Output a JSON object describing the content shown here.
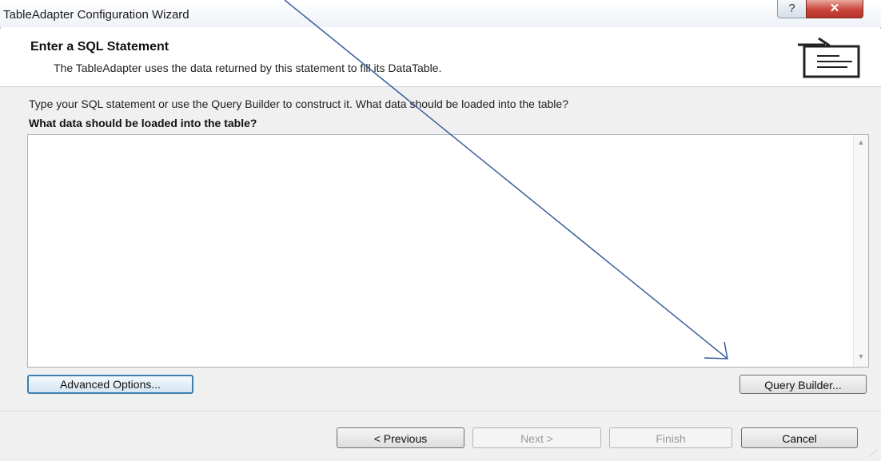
{
  "window": {
    "title": "TableAdapter Configuration Wizard",
    "help_label": "?",
    "close_label": "✕"
  },
  "header": {
    "title": "Enter a SQL Statement",
    "description": "The TableAdapter uses the data returned by this statement to fill its DataTable.",
    "icon": "wizard-table-icon"
  },
  "main": {
    "instructions": "Type your SQL statement or use the Query Builder to construct it. What data should be loaded into the table?",
    "prompt": "What data should be loaded into the table?",
    "sql_value": "",
    "advanced_options_label": "Advanced Options...",
    "query_builder_label": "Query Builder..."
  },
  "footer": {
    "previous_label": "< Previous",
    "next_label": "Next >",
    "finish_label": "Finish",
    "cancel_label": "Cancel"
  },
  "colors": {
    "annotation_arrow": "#3a5e9c",
    "close_button": "#c9453a"
  }
}
